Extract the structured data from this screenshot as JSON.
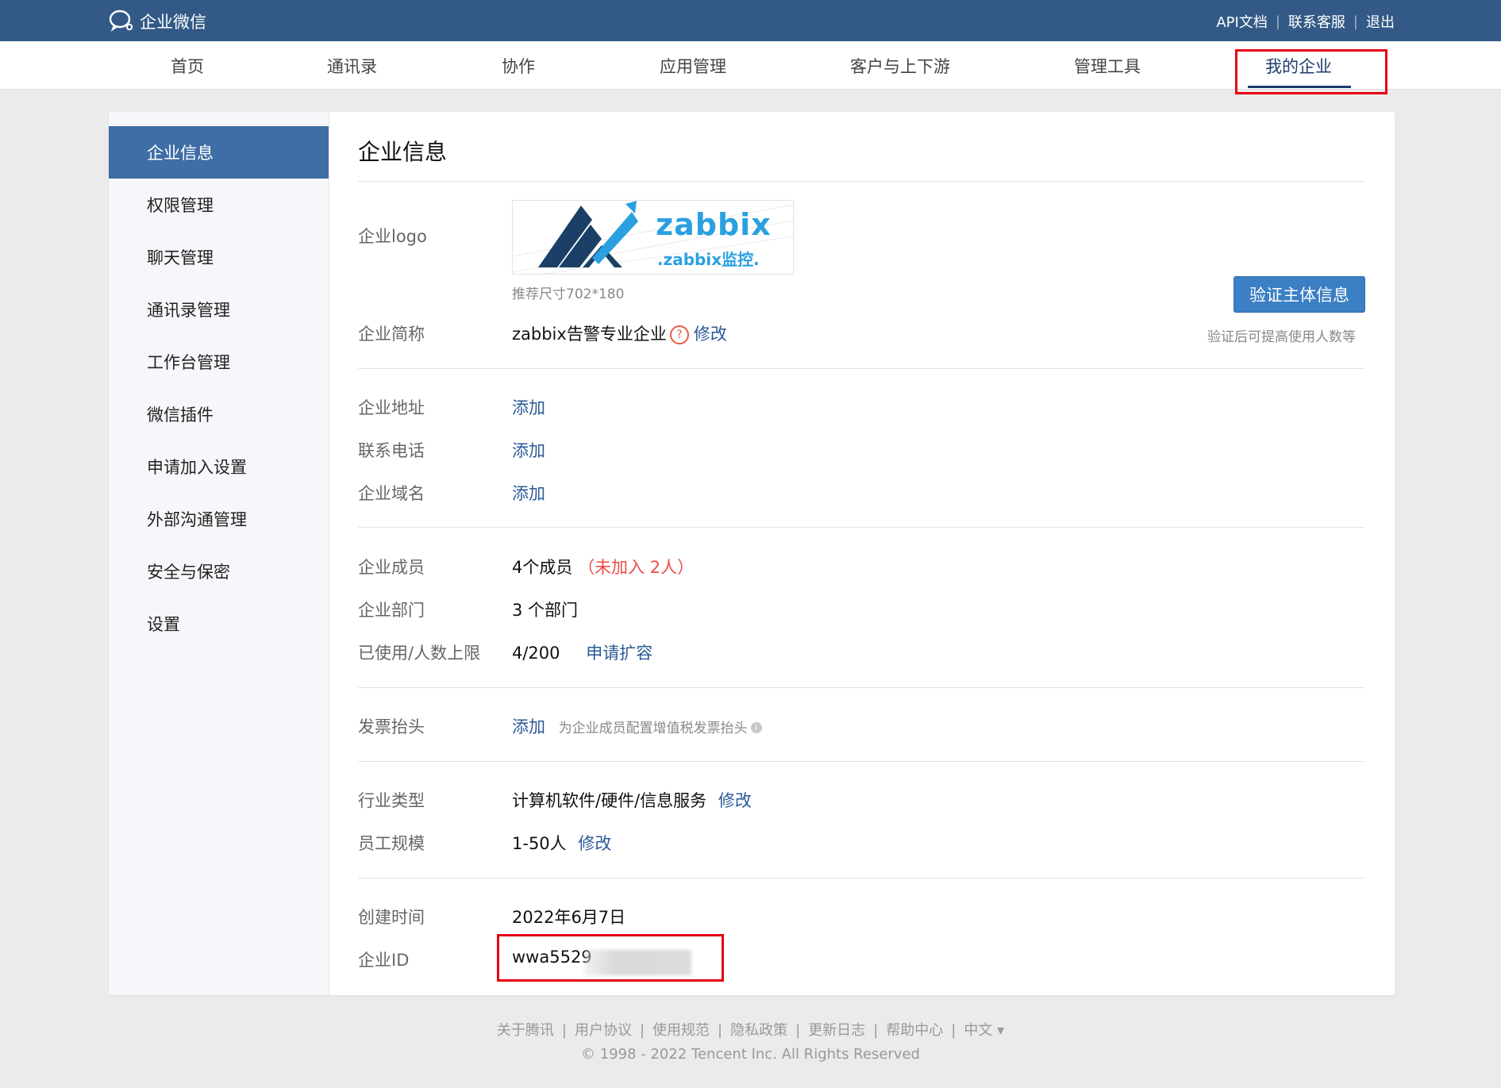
{
  "app": {
    "brand": "企业微信"
  },
  "toplinks": {
    "api_docs": "API文档",
    "support": "联系客服",
    "logout": "退出"
  },
  "nav": [
    "首页",
    "通讯录",
    "协作",
    "应用管理",
    "客户与上下游",
    "管理工具",
    "我的企业"
  ],
  "sidebar": [
    "企业信息",
    "权限管理",
    "聊天管理",
    "通讯录管理",
    "工作台管理",
    "微信插件",
    "申请加入设置",
    "外部沟通管理",
    "安全与保密",
    "设置"
  ],
  "main": {
    "title": "企业信息",
    "logo": {
      "label": "企业logo",
      "text_main": "zabbix",
      "text_sub": ".zabbix监控.",
      "size_hint": "推荐尺寸702*180"
    },
    "verify": {
      "button": "验证主体信息",
      "hint": "验证后可提高使用人数等"
    },
    "short_name": {
      "label": "企业简称",
      "value": "zabbix告警专业企业",
      "edit": "修改"
    },
    "address": {
      "label": "企业地址",
      "action": "添加"
    },
    "phone": {
      "label": "联系电话",
      "action": "添加"
    },
    "domain": {
      "label": "企业域名",
      "action": "添加"
    },
    "members": {
      "label": "企业成员",
      "value": "4个成员",
      "pending": "（未加入 2人）"
    },
    "departments": {
      "label": "企业部门",
      "value": "3 个部门"
    },
    "usage": {
      "label": "已使用/人数上限",
      "value": "4/200",
      "action": "申请扩容"
    },
    "invoice": {
      "label": "发票抬头",
      "action": "添加",
      "hint": "为企业成员配置增值税发票抬头"
    },
    "industry": {
      "label": "行业类型",
      "value": "计算机软件/硬件/信息服务",
      "edit": "修改"
    },
    "scale": {
      "label": "员工规模",
      "value": "1-50人",
      "edit": "修改"
    },
    "created": {
      "label": "创建时间",
      "value": "2022年6月7日"
    },
    "corp_id": {
      "label": "企业ID",
      "value": "wwa5529"
    }
  },
  "footer": {
    "links": [
      "关于腾讯",
      "用户协议",
      "使用规范",
      "隐私政策",
      "更新日志",
      "帮助中心"
    ],
    "language": "中文 ▾",
    "copyright": "© 1998 - 2022 Tencent Inc. All Rights Reserved"
  },
  "colors": {
    "topbar": "#335a86",
    "active_side": "#3f6ea6",
    "link": "#2a5a96",
    "highlight": "#e60012",
    "button": "#3b7fc4"
  }
}
